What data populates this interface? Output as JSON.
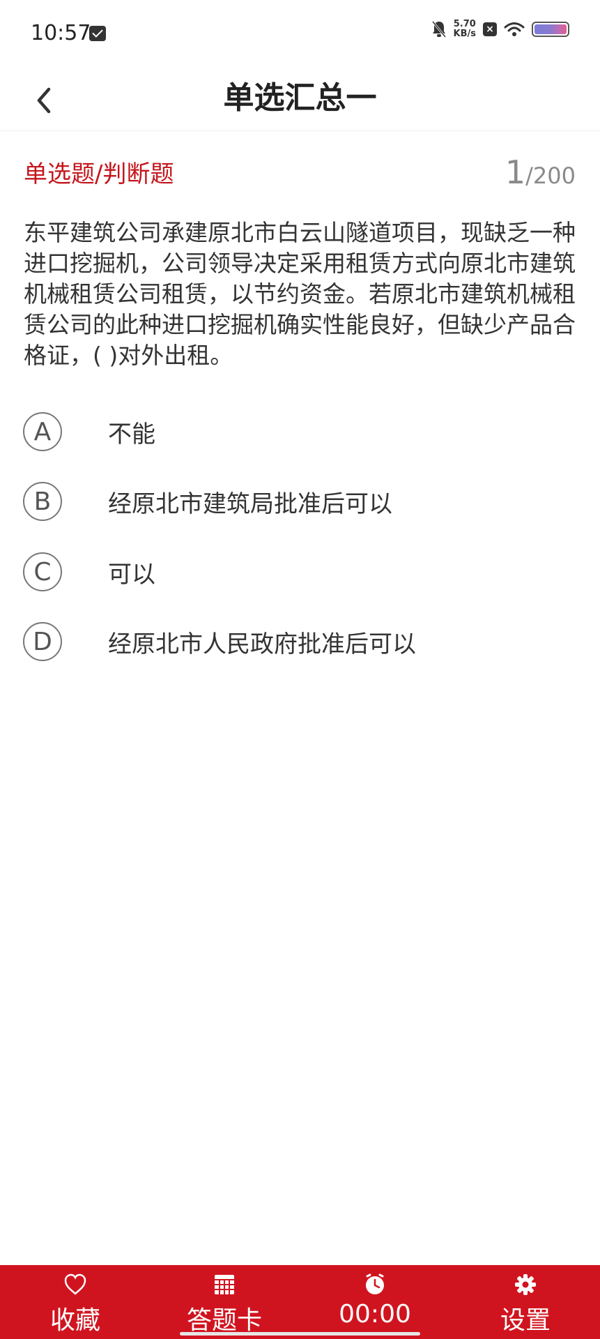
{
  "status_bar": {
    "time": "10:57",
    "net_speed_value": "5.70",
    "net_speed_unit": "KB/s",
    "battery_level": 1.0
  },
  "header": {
    "title": "单选汇总一"
  },
  "question": {
    "type_label": "单选题/判断题",
    "current": "1",
    "total": "/200",
    "text": "东平建筑公司承建原北市白云山隧道项目，现缺乏一种进口挖掘机，公司领导决定采用租赁方式向原北市建筑机械租赁公司租赁，以节约资金。若原北市建筑机械租赁公司的此种进口挖掘机确实性能良好，但缺少产品合格证，( )对外出租。",
    "options": [
      {
        "letter": "A",
        "text": "不能"
      },
      {
        "letter": "B",
        "text": "经原北市建筑局批准后可以"
      },
      {
        "letter": "C",
        "text": "可以"
      },
      {
        "letter": "D",
        "text": "经原北市人民政府批准后可以"
      }
    ]
  },
  "bottom_bar": {
    "favorite_label": "收藏",
    "answer_card_label": "答题卡",
    "timer_label": "00:00",
    "settings_label": "设置"
  },
  "colors": {
    "accent": "#d0141f",
    "type_label": "#c4161c"
  },
  "icons": {
    "back": "chevron-left-icon",
    "favorite": "heart-icon",
    "answer_card": "grid-icon",
    "timer": "clock-icon",
    "settings": "gear-icon"
  }
}
